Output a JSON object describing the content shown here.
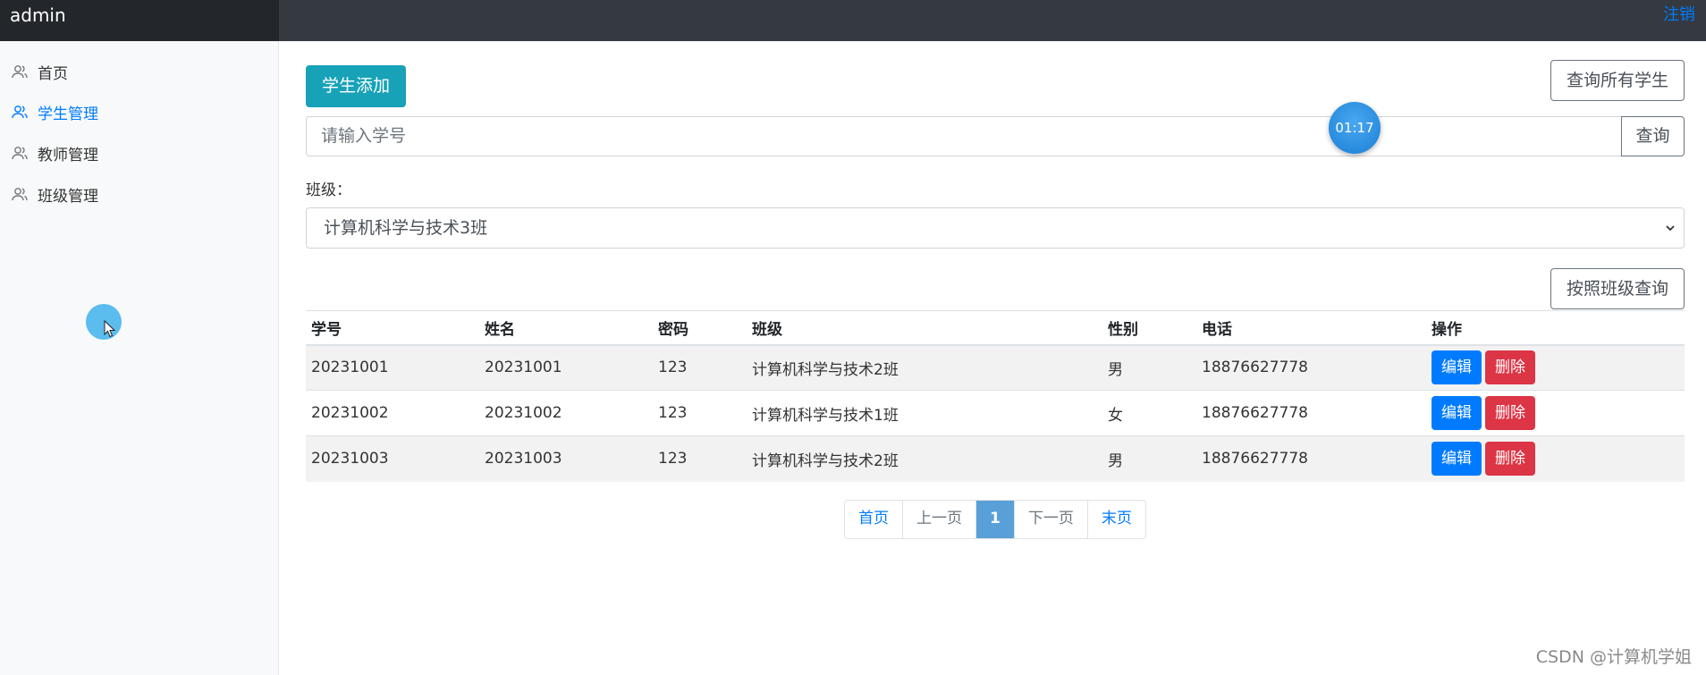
{
  "app": {
    "brand": "admin",
    "logout_label": "注销"
  },
  "sidebar": {
    "items": [
      {
        "label": "首页",
        "icon": "users-icon",
        "active": false
      },
      {
        "label": "学生管理",
        "icon": "users-icon",
        "active": true
      },
      {
        "label": "教师管理",
        "icon": "users-icon",
        "active": false
      },
      {
        "label": "班级管理",
        "icon": "users-icon",
        "active": false
      }
    ]
  },
  "toolbar": {
    "add_label": "学生添加",
    "query_all_label": "查询所有学生",
    "search_placeholder": "请输入学号",
    "search_label": "查询",
    "class_label": "班级：",
    "class_selected": "计算机科学与技术3班",
    "query_by_class_label": "按照班级查询"
  },
  "timer": {
    "text": "01:17"
  },
  "table": {
    "headers": [
      "学号",
      "姓名",
      "密码",
      "班级",
      "性别",
      "电话",
      "操作"
    ],
    "rows": [
      [
        "20231001",
        "20231001",
        "123",
        "计算机科学与技术2班",
        "男",
        "18876627778"
      ],
      [
        "20231002",
        "20231002",
        "123",
        "计算机科学与技术1班",
        "女",
        "18876627778"
      ],
      [
        "20231003",
        "20231003",
        "123",
        "计算机科学与技术2班",
        "男",
        "18876627778"
      ]
    ],
    "edit_label": "编辑",
    "delete_label": "删除"
  },
  "pagination": {
    "first": "首页",
    "prev": "上一页",
    "current": "1",
    "next": "下一页",
    "last": "末页"
  },
  "watermark": "CSDN @计算机学姐",
  "colors": {
    "accent": "#007bff",
    "add_button": "#17a2b8",
    "danger": "#dc3545",
    "topbar": "#343a40"
  }
}
